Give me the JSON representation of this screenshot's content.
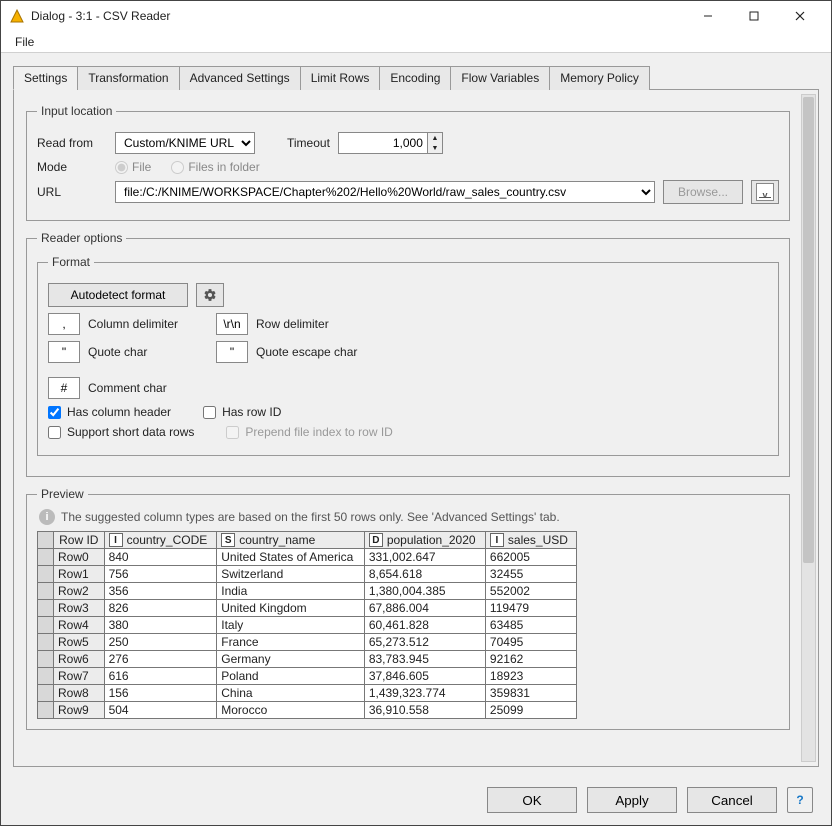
{
  "window": {
    "title": "Dialog - 3:1 - CSV Reader"
  },
  "menubar": {
    "file": "File"
  },
  "tabs": [
    "Settings",
    "Transformation",
    "Advanced Settings",
    "Limit Rows",
    "Encoding",
    "Flow Variables",
    "Memory Policy"
  ],
  "input_location": {
    "legend": "Input location",
    "read_from_label": "Read from",
    "read_from_value": "Custom/KNIME URL",
    "timeout_label": "Timeout",
    "timeout_value": "1,000",
    "mode_label": "Mode",
    "mode_file": "File",
    "mode_folder": "Files in folder",
    "url_label": "URL",
    "url_value": "file:/C:/KNIME/WORKSPACE/Chapter%202/Hello%20World/raw_sales_country.csv",
    "browse_label": "Browse..."
  },
  "reader_options": {
    "legend": "Reader options",
    "format_legend": "Format",
    "autodetect_label": "Autodetect format",
    "col_delim_value": ",",
    "col_delim_label": "Column delimiter",
    "row_delim_value": "\\r\\n",
    "row_delim_label": "Row delimiter",
    "quote_value": "\"",
    "quote_label": "Quote char",
    "quote_esc_value": "\"",
    "quote_esc_label": "Quote escape char",
    "comment_value": "#",
    "comment_label": "Comment char",
    "has_col_header": "Has column header",
    "has_row_id": "Has row ID",
    "support_short": "Support short data rows",
    "prepend_index": "Prepend file index to row ID"
  },
  "preview": {
    "legend": "Preview",
    "note": "The suggested column types are based on the first 50 rows only. See 'Advanced Settings' tab.",
    "rowid_header": "Row ID",
    "columns": [
      {
        "type": "I",
        "name": "country_CODE"
      },
      {
        "type": "S",
        "name": "country_name"
      },
      {
        "type": "D",
        "name": "population_2020"
      },
      {
        "type": "I",
        "name": "sales_USD"
      }
    ],
    "rows": [
      {
        "id": "Row0",
        "cells": [
          "840",
          "United States of America",
          "331,002.647",
          "662005"
        ]
      },
      {
        "id": "Row1",
        "cells": [
          "756",
          "Switzerland",
          "8,654.618",
          "32455"
        ]
      },
      {
        "id": "Row2",
        "cells": [
          "356",
          "India",
          "1,380,004.385",
          "552002"
        ]
      },
      {
        "id": "Row3",
        "cells": [
          "826",
          "United Kingdom",
          "67,886.004",
          "119479"
        ]
      },
      {
        "id": "Row4",
        "cells": [
          "380",
          "Italy",
          "60,461.828",
          "63485"
        ]
      },
      {
        "id": "Row5",
        "cells": [
          "250",
          "France",
          "65,273.512",
          "70495"
        ]
      },
      {
        "id": "Row6",
        "cells": [
          "276",
          "Germany",
          "83,783.945",
          "92162"
        ]
      },
      {
        "id": "Row7",
        "cells": [
          "616",
          "Poland",
          "37,846.605",
          "18923"
        ]
      },
      {
        "id": "Row8",
        "cells": [
          "156",
          "China",
          "1,439,323.774",
          "359831"
        ]
      },
      {
        "id": "Row9",
        "cells": [
          "504",
          "Morocco",
          "36,910.558",
          "25099"
        ]
      }
    ]
  },
  "footer": {
    "ok": "OK",
    "apply": "Apply",
    "cancel": "Cancel"
  }
}
